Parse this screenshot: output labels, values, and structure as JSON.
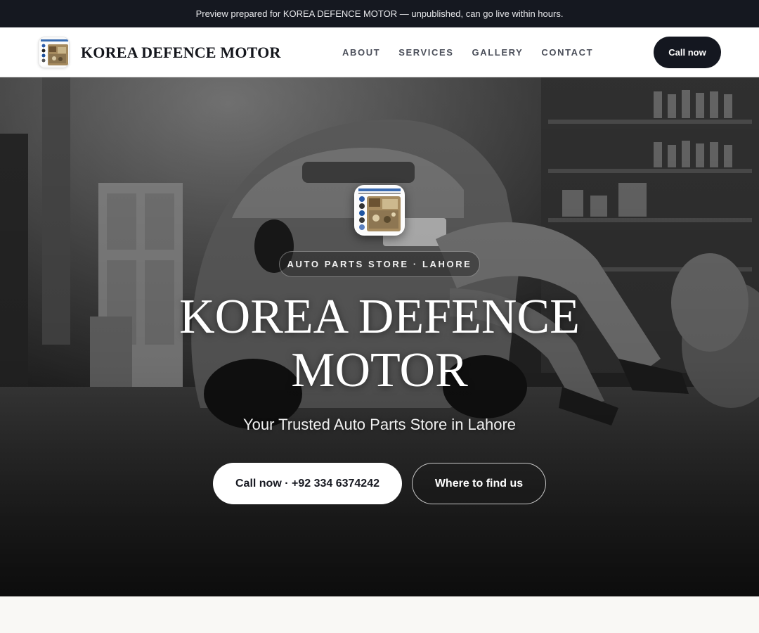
{
  "preview_bar": {
    "text": "Preview prepared for KOREA DEFENCE MOTOR — unpublished, can go live within hours."
  },
  "header": {
    "brand_name": "KOREA DEFENCE MOTOR",
    "nav": [
      "ABOUT",
      "SERVICES",
      "GALLERY",
      "CONTACT"
    ],
    "call_label": "Call now"
  },
  "hero": {
    "eyebrow": "AUTO PARTS STORE · LAHORE",
    "title_line1": "KOREA DEFENCE",
    "title_line2": "MOTOR",
    "subtitle": "Your Trusted Auto Parts Store in Lahore",
    "primary_button": "Call now · +92 334 6374242",
    "secondary_button": "Where to find us"
  },
  "colors": {
    "dark": "#141720",
    "preview_bar_bg": "#151820",
    "header_bg": "#ffffff",
    "page_bg": "#f9f8f5"
  }
}
